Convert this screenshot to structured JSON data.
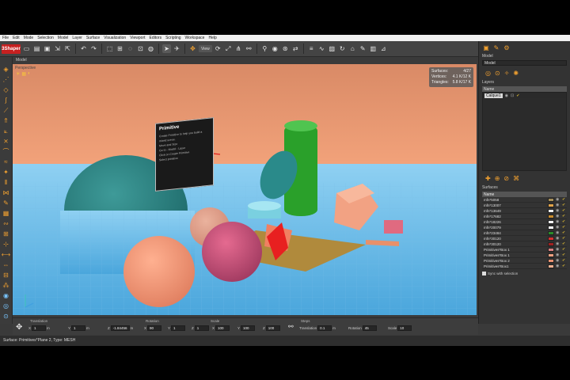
{
  "menu": [
    "File",
    "Edit",
    "Mode",
    "Selection",
    "Model",
    "Layer",
    "Surface",
    "Visualization",
    "Viewport",
    "Editors",
    "Scripting",
    "Workspace",
    "Help"
  ],
  "app": {
    "logo_text": "3Shaper"
  },
  "toolbar": {
    "view_dropdown": "View"
  },
  "mode_label": "Model",
  "viewport": {
    "label": "Perspective"
  },
  "stats": {
    "surfaces_label": "Surfaces:",
    "surfaces_value": "4/27",
    "vertices_label": "Vertices:",
    "vertices_value": "4.1 K/12 K",
    "triangles_label": "Triangles:",
    "triangles_value": "5.8 K/17 K"
  },
  "tooltip": {
    "title": "Primitive",
    "lines": [
      "Create Primitive to help you build a",
      "mixed scene.",
      "Move and Size",
      "Go to - Model - Layer",
      "Click on Create Primitive",
      "Select primitive"
    ]
  },
  "right_panel": {
    "model_label": "Model",
    "model_select": "Model",
    "layers_label": "Layers",
    "name_header": "Name",
    "layer_name": "Calque1",
    "surfaces_label": "Surfaces",
    "surfaces": [
      {
        "name": "mfn*5058",
        "color": "#a78f58"
      },
      {
        "name": "mfn*13007",
        "color": "#e2a44a"
      },
      {
        "name": "mfn*13649",
        "color": "#f2f2f2"
      },
      {
        "name": "mfn*17682",
        "color": "#c88b2c"
      },
      {
        "name": "mfn*18226",
        "color": "#f8f8f8"
      },
      {
        "name": "mfn*20079",
        "color": "#ffffff"
      },
      {
        "name": "mfn*23484",
        "color": "#2a8a2a"
      },
      {
        "name": "mfn*30120",
        "color": "#d43030"
      },
      {
        "name": "mfn*30120",
        "color": "#a02020"
      },
      {
        "name": "Primitives*Box 1",
        "color": "#d88080"
      },
      {
        "name": "Primitives*Box 1",
        "color": "#f0a080"
      },
      {
        "name": "Primitives*Box 2",
        "color": "#e89070"
      },
      {
        "name": "Primitives*Box1",
        "color": "#f0b090"
      }
    ],
    "sync_label": "Sync with selection"
  },
  "transform": {
    "translation_label": "Translation",
    "rotation_label": "Rotation",
    "scale_label": "Scale",
    "steps_label": "Steps",
    "tx": "1",
    "ty": "1",
    "tz": "-1.84456",
    "rx": "90",
    "ry": "1",
    "rz": "1",
    "sx": "100",
    "sy": "100",
    "sz": "100",
    "unit_m": "m",
    "step_translation_label": "Translation",
    "step_translation": "0.1",
    "step_rotation_label": "Rotation",
    "step_rotation": "45",
    "step_scale_label": "Scale",
    "step_scale": "10"
  },
  "status": "Surface: Primitives*Plane 2, Type: MESH",
  "colors": {
    "accent": "#f0a030",
    "sky": "#e89870",
    "floor": "#5ab0e0"
  }
}
